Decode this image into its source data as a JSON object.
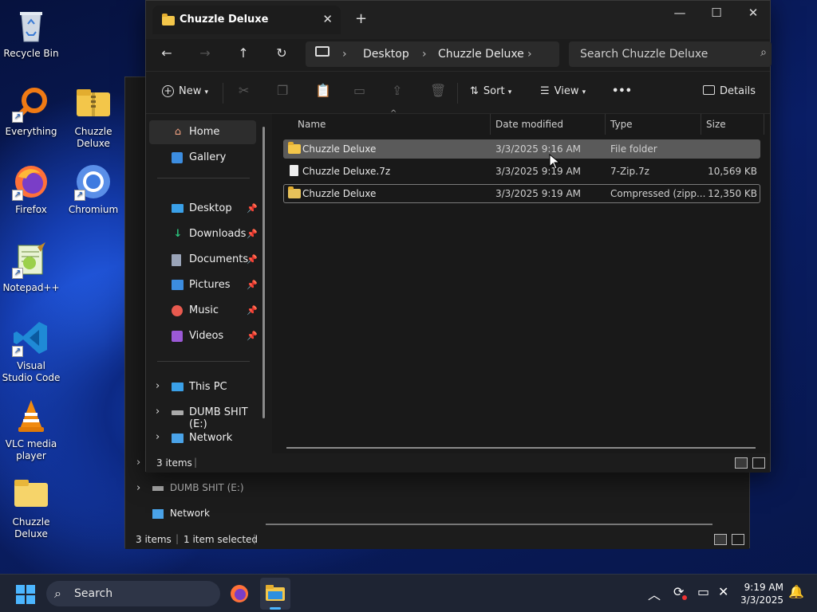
{
  "desktop": {
    "icons": [
      {
        "label": "Recycle Bin",
        "icon": "recycle-bin-icon"
      },
      {
        "label": "Everything",
        "icon": "everything-search-icon"
      },
      {
        "label": "Chuzzle Deluxe",
        "icon": "zip-folder-icon"
      },
      {
        "label": "Firefox",
        "icon": "firefox-icon"
      },
      {
        "label": "Chromium",
        "icon": "chromium-icon"
      },
      {
        "label": "Notepad++",
        "icon": "notepadpp-icon"
      },
      {
        "label": "Visual Studio Code",
        "icon": "vscode-icon"
      },
      {
        "label": "VLC media player",
        "icon": "vlc-icon"
      },
      {
        "label": "Chuzzle Deluxe",
        "icon": "folder-icon"
      }
    ]
  },
  "back_window": {
    "sidebar": [
      {
        "label": "DUMB SHIT (E:)",
        "icon": "drive-icon"
      },
      {
        "label": "Network",
        "icon": "network-icon"
      }
    ],
    "status": {
      "count": "3 items",
      "selection": "1 item selected"
    }
  },
  "window": {
    "tab_title": "Chuzzle Deluxe",
    "new_tab": "+",
    "controls": {
      "minimize": "—",
      "maximize": "☐",
      "close": "✕"
    },
    "nav": {
      "back": "←",
      "forward": "→",
      "up": "↑",
      "refresh": "↻"
    },
    "breadcrumb": [
      "Desktop",
      "Chuzzle Deluxe"
    ],
    "search_placeholder": "Search Chuzzle Deluxe",
    "commands": {
      "new": "New",
      "sort": "Sort",
      "view": "View",
      "more": "•••",
      "details": "Details"
    },
    "sidebar": {
      "home": "Home",
      "gallery": "Gallery",
      "pinned": [
        {
          "label": "Desktop",
          "icon": "desktop-icon",
          "color": "#3aa0e8"
        },
        {
          "label": "Downloads",
          "icon": "downloads-icon",
          "color": "#2bbf7a"
        },
        {
          "label": "Documents",
          "icon": "documents-icon",
          "color": "#9aa4b8"
        },
        {
          "label": "Pictures",
          "icon": "pictures-icon",
          "color": "#3c8de0"
        },
        {
          "label": "Music",
          "icon": "music-icon",
          "color": "#e85a4f"
        },
        {
          "label": "Videos",
          "icon": "videos-icon",
          "color": "#9b59d6"
        }
      ],
      "locations": [
        {
          "label": "This PC",
          "icon": "this-pc-icon"
        },
        {
          "label": "DUMB SHIT (E:)",
          "icon": "drive-icon"
        },
        {
          "label": "Network",
          "icon": "network-icon"
        }
      ]
    },
    "columns": [
      "Name",
      "Date modified",
      "Type",
      "Size"
    ],
    "files": [
      {
        "name": "Chuzzle Deluxe",
        "date": "3/3/2025 9:16 AM",
        "type": "File folder",
        "size": "",
        "icon": "folder-icon"
      },
      {
        "name": "Chuzzle Deluxe.7z",
        "date": "3/3/2025 9:19 AM",
        "type": "7-Zip.7z",
        "size": "10,569 KB",
        "icon": "file-icon"
      },
      {
        "name": "Chuzzle Deluxe",
        "date": "3/3/2025 9:19 AM",
        "type": "Compressed (zipp...",
        "size": "12,350 KB",
        "icon": "zip-folder-icon"
      }
    ],
    "status": {
      "count": "3 items"
    }
  },
  "taskbar": {
    "search_placeholder": "Search",
    "time": "9:19 AM",
    "date": "3/3/2025"
  },
  "colors": {
    "accent": "#f3c64a",
    "selection": "#5a5a5a",
    "window_bg": "#1c1c1c"
  }
}
